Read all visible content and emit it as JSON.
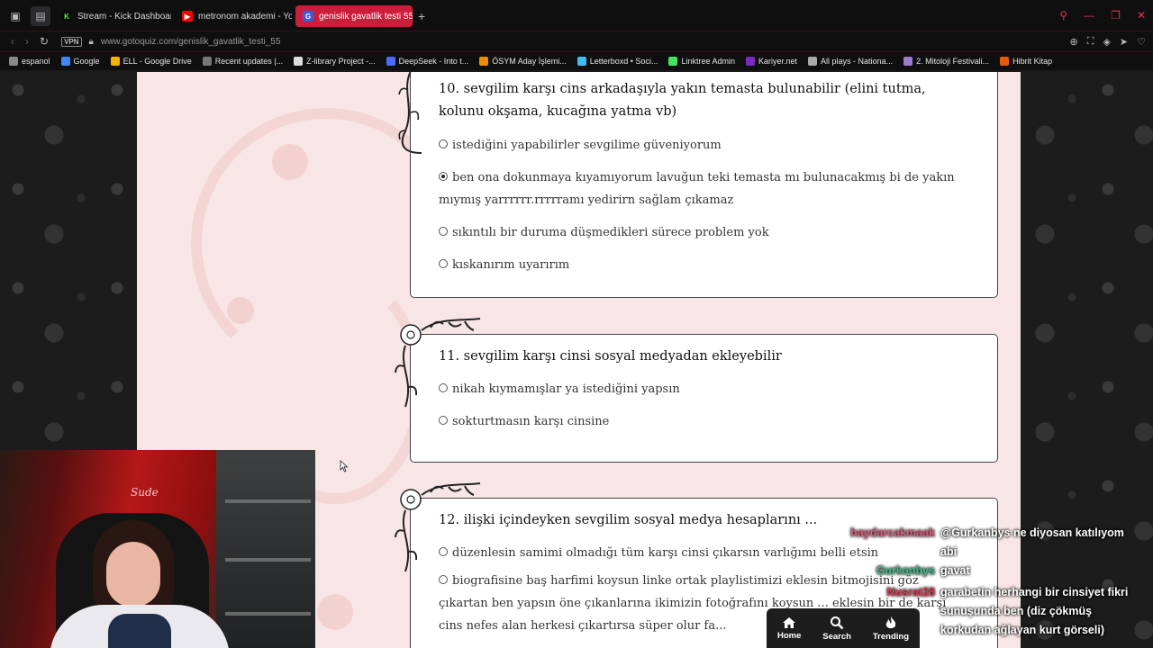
{
  "browser": {
    "tabs": [
      {
        "label": "Stream - Kick Dashboard",
        "favicon_color": "#53fc18",
        "favicon": "K",
        "active": false
      },
      {
        "label": "metronom akademi - YouTube",
        "favicon_color": "#ff0000",
        "favicon": "▶",
        "active": false
      },
      {
        "label": "genislik gavatlik testi 55",
        "favicon_color": "#3b5bdb",
        "favicon": "G",
        "active": true
      }
    ],
    "new_tab": "+",
    "url": "www.gotoquiz.com/genislik_gavatlik_testi_55",
    "vpn_label": "VPN",
    "bookmarks": [
      {
        "label": "espanol",
        "color": "#888888"
      },
      {
        "label": "Google",
        "color": "#4285f4"
      },
      {
        "label": "ELL - Google Drive",
        "color": "#f4b400"
      },
      {
        "label": "Recent updates |...",
        "color": "#777777"
      },
      {
        "label": "Z-library Project -...",
        "color": "#dddddd"
      },
      {
        "label": "DeepSeek - Into t...",
        "color": "#4d6bfe"
      },
      {
        "label": "ÖSYM Aday İşlemi...",
        "color": "#f08c00"
      },
      {
        "label": "Letterboxd • Soci...",
        "color": "#40bcf4"
      },
      {
        "label": "Linktree Admin",
        "color": "#43e660"
      },
      {
        "label": "Kariyer.net",
        "color": "#7b2cbf"
      },
      {
        "label": "All plays - Nationa...",
        "color": "#aaaaaa"
      },
      {
        "label": "2. Mitoloji Festivali...",
        "color": "#9b7bd0"
      },
      {
        "label": "Hibrit Kitap",
        "color": "#e8590c"
      }
    ]
  },
  "quiz": {
    "questions": [
      {
        "title": "10. sevgilim karşı cins arkadaşıyla yakın temasta bulunabilir (elini tutma, kolunu okşama, kucağına yatma vb)",
        "options": [
          {
            "text": "istediğini yapabilirler sevgilime güveniyorum",
            "checked": false
          },
          {
            "text": "ben ona dokunmaya kıyamıyorum lavuğun teki temasta mı bulunacakmış bi de yakın mıymış yarrrrrr.rrrrramı yedirirn sağlam çıkamaz",
            "checked": true
          },
          {
            "text": "sıkıntılı bir duruma düşmedikleri sürece problem yok",
            "checked": false
          },
          {
            "text": "kıskanırım uyarırım",
            "checked": false
          }
        ]
      },
      {
        "title": "11. sevgilim karşı cinsi sosyal medyadan ekleyebilir",
        "options": [
          {
            "text": "nikah kıymamışlar ya istediğini yapsın",
            "checked": false
          },
          {
            "text": "sokturtmasın karşı cinsine",
            "checked": false
          }
        ]
      },
      {
        "title": "12. ilişki içindeyken sevgilim sosyal medya hesaplarını ...",
        "options": [
          {
            "text": "düzenlesin samimi olmadığı tüm karşı cinsi çıkarsın varlığımı belli etsin",
            "checked": false
          },
          {
            "text": "biografisine baş harfimi koysun linke ortak playlistimizi eklesin bitmojisini göz çıkartan ben yapsın öne çıkanlarına ikimizin fotoğrafını koysun ... eklesin bir de karşı cins nefes alan herkesi çıkartırsa süper olur fa...",
            "checked": false
          }
        ]
      }
    ]
  },
  "webcam": {
    "signature": "Sude"
  },
  "chat": [
    {
      "user": "haydarcakmaak",
      "user_color": "#e05a7a",
      "message": "@Gurkanbys ne diyosan katılıyom abi"
    },
    {
      "user": "Gurkanbys",
      "user_color": "#3fb98a",
      "message": "gavat"
    },
    {
      "user": "Nusrat28",
      "user_color": "#e0384f",
      "message": "garabetin herhangi bir cinsiyet fikri sunuşunda ben (diz çökmüş korkudan ağlayan kurt görseli)"
    }
  ],
  "bottom_nav": [
    {
      "label": "Home",
      "icon": "home-icon"
    },
    {
      "label": "Search",
      "icon": "search-icon"
    },
    {
      "label": "Trending",
      "icon": "flame-icon"
    }
  ]
}
